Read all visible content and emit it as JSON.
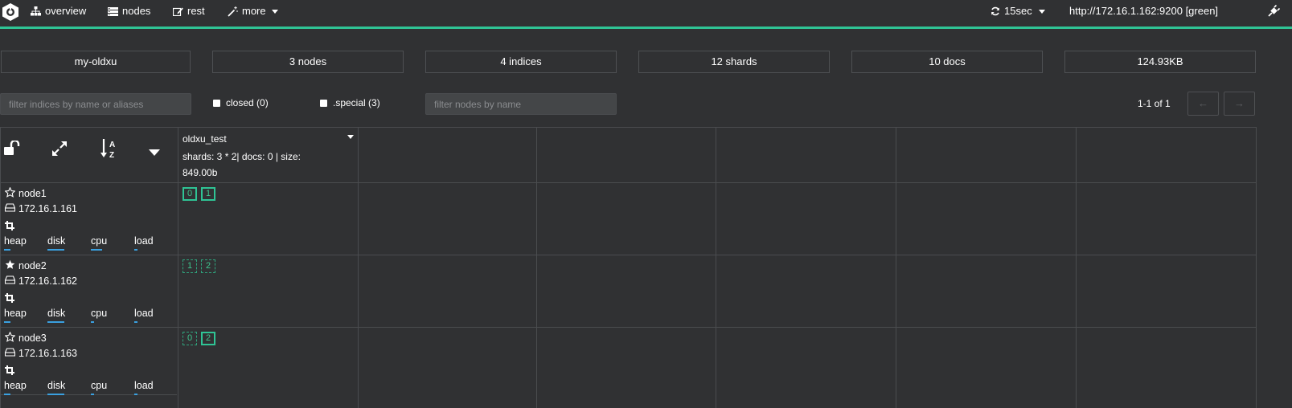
{
  "nav": {
    "items": [
      {
        "label": "overview",
        "icon": "sitemap-icon"
      },
      {
        "label": "nodes",
        "icon": "server-icon"
      },
      {
        "label": "rest",
        "icon": "edit-icon"
      },
      {
        "label": "more",
        "icon": "magic-wand-icon"
      }
    ],
    "refresh_label": "15sec",
    "cluster_url": "http://172.16.1.162:9200 [green]",
    "accent": "#2fc495"
  },
  "stats": {
    "cluster_name": "my-oldxu",
    "nodes": "3 nodes",
    "indices": "4 indices",
    "shards": "12 shards",
    "docs": "10 docs",
    "size": "124.93KB"
  },
  "filters": {
    "indices_placeholder": "filter indices by name or aliases",
    "closed_label": "closed (0)",
    "special_label": ".special (3)",
    "nodes_placeholder": "filter nodes by name",
    "pager_text": "1-1 of 1",
    "prev": "←",
    "next": "→"
  },
  "index": {
    "name": "oldxu_test",
    "info": "shards: 3 * 2| docs: 0 | size: 849.00b"
  },
  "nodes": [
    {
      "name": "node1",
      "ip": "172.16.1.161",
      "master": false,
      "metrics": [
        "heap",
        "disk",
        "cpu",
        "load"
      ],
      "shards": [
        {
          "id": "0",
          "primary": true
        },
        {
          "id": "1",
          "primary": true
        }
      ]
    },
    {
      "name": "node2",
      "ip": "172.16.1.162",
      "master": true,
      "metrics": [
        "heap",
        "disk",
        "cpu",
        "load"
      ],
      "shards": [
        {
          "id": "1",
          "primary": false
        },
        {
          "id": "2",
          "primary": false
        }
      ]
    },
    {
      "name": "node3",
      "ip": "172.16.1.163",
      "master": false,
      "metrics": [
        "heap",
        "disk",
        "cpu",
        "load"
      ],
      "shards": [
        {
          "id": "0",
          "primary": false
        },
        {
          "id": "2",
          "primary": true
        }
      ]
    }
  ]
}
